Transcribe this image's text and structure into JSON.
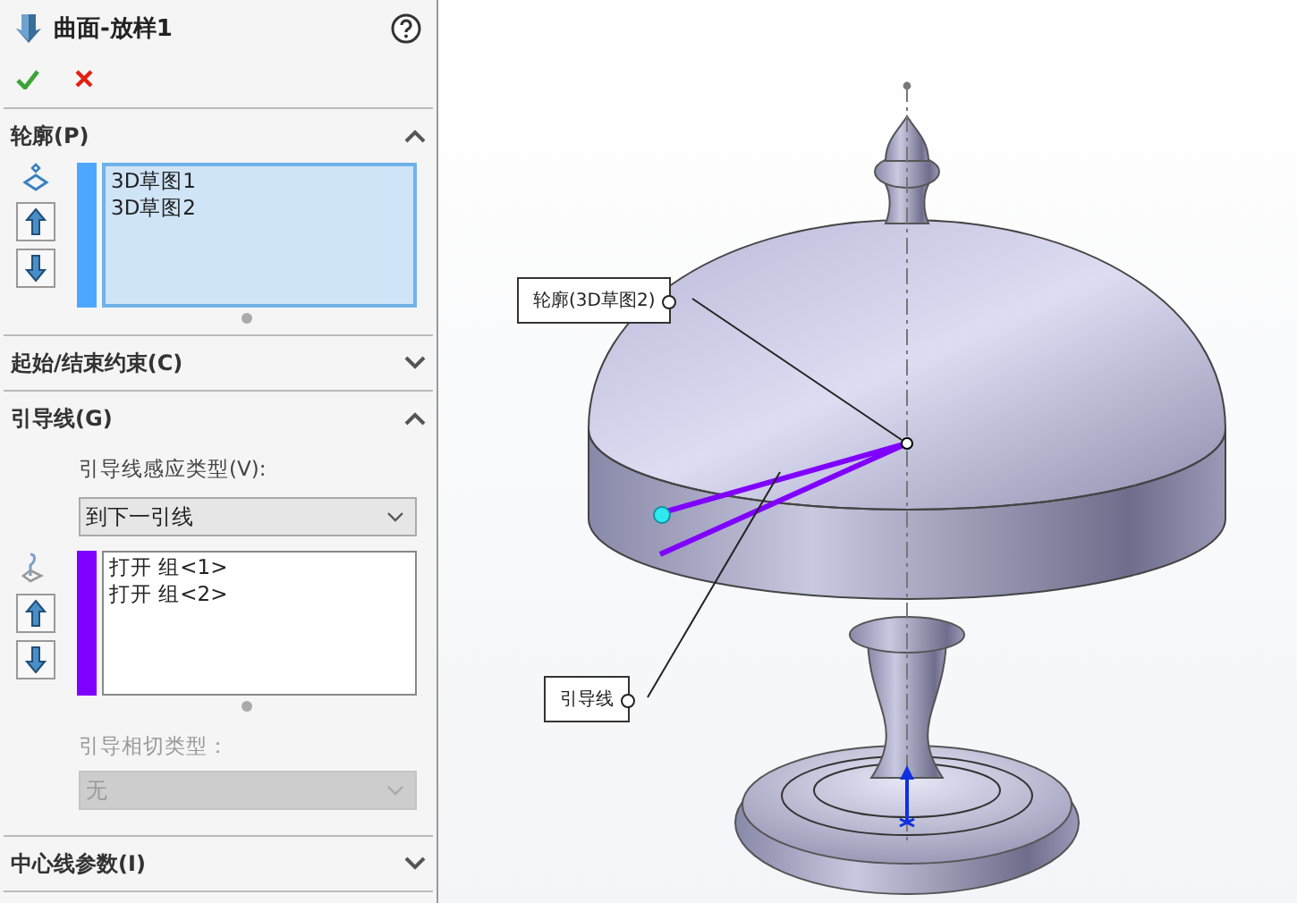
{
  "panel": {
    "title": "曲面-放样1",
    "sections": [
      {
        "kind": "profile",
        "title": "轮廓(P)",
        "expanded": true,
        "color": "#4da6ff",
        "items": [
          "3D草图1",
          "3D草图2"
        ]
      },
      {
        "title": "起始/结束约束(C)",
        "expanded": false
      },
      {
        "kind": "guides",
        "title": "引导线(G)",
        "expanded": true,
        "color": "#8000ff",
        "influence_label": "引导线感应类型(V):",
        "influence_value": "到下一引线",
        "items": [
          "打开 组<1>",
          "打开 组<2>"
        ],
        "tangency_label": "引导相切类型：",
        "tangency_value": "无",
        "tangency_disabled": true
      },
      {
        "title": "中心线参数(I)",
        "expanded": false
      }
    ]
  },
  "viewport": {
    "callouts": [
      {
        "text": "轮廓(3D草图2)"
      },
      {
        "text": "引导线"
      }
    ]
  }
}
